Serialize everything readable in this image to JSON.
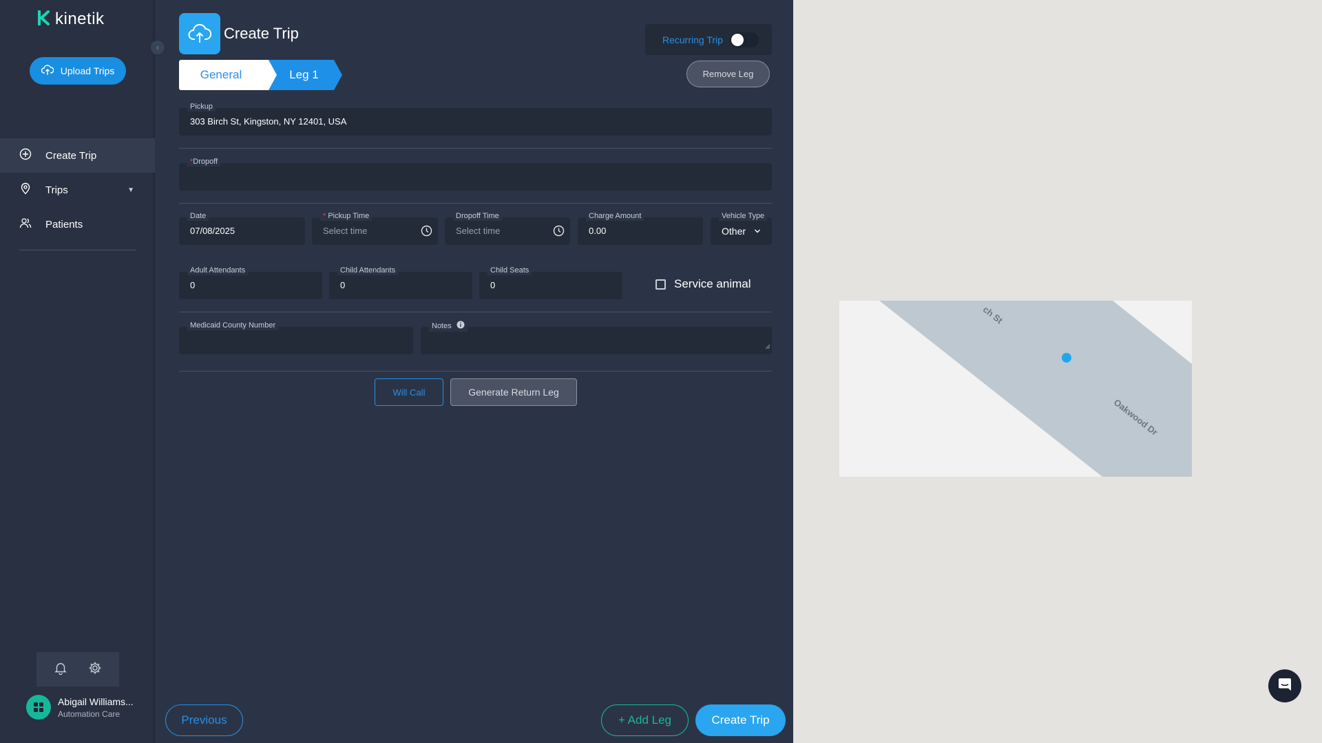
{
  "brand": {
    "name": "kinetik",
    "accent": "#2aa5f0",
    "logo_color": "#1ad6b4"
  },
  "sidebar": {
    "upload_label": "Upload Trips",
    "items": [
      {
        "label": "Create Trip",
        "icon": "plus-circle-icon",
        "active": true
      },
      {
        "label": "Trips",
        "icon": "map-pin-icon",
        "has_dropdown": true
      },
      {
        "label": "Patients",
        "icon": "users-icon"
      }
    ],
    "user": {
      "name": "Abigail Williams...",
      "org": "Automation Care"
    }
  },
  "header": {
    "title": "Create Trip",
    "recurring_label": "Recurring Trip",
    "recurring_on": false
  },
  "tabs": {
    "general": "General",
    "leg": "Leg 1"
  },
  "remove_leg": "Remove Leg",
  "form": {
    "pickup": {
      "label": "Pickup",
      "value": "303 Birch St, Kingston, NY 12401, USA"
    },
    "dropoff": {
      "required": "*",
      "label": "Dropoff",
      "value": ""
    },
    "date": {
      "label": "Date",
      "value": "07/08/2025"
    },
    "pickup_time": {
      "required": "*",
      "label": " Pickup Time",
      "placeholder": "Select time"
    },
    "dropoff_time": {
      "label": "Dropoff Time",
      "placeholder": "Select time"
    },
    "charge_amount": {
      "label": "Charge Amount",
      "value": "0.00"
    },
    "vehicle_type": {
      "label": "Vehicle Type",
      "value": "Other"
    },
    "adult_attendants": {
      "label": "Adult Attendants",
      "value": "0"
    },
    "child_attendants": {
      "label": "Child Attendants",
      "value": "0"
    },
    "child_seats": {
      "label": "Child Seats",
      "value": "0"
    },
    "service_animal": {
      "label": "Service animal",
      "checked": false
    },
    "medicaid": {
      "label": "Medicaid County Number",
      "value": ""
    },
    "notes": {
      "label": "Notes",
      "value": ""
    }
  },
  "actions": {
    "will_call": "Will Call",
    "generate_return": "Generate Return Leg"
  },
  "footer": {
    "previous": "Previous",
    "add_leg": "+ Add Leg",
    "create": "Create Trip"
  },
  "map": {
    "street_1": "ch St",
    "street_2": "Oakwood Dr"
  }
}
